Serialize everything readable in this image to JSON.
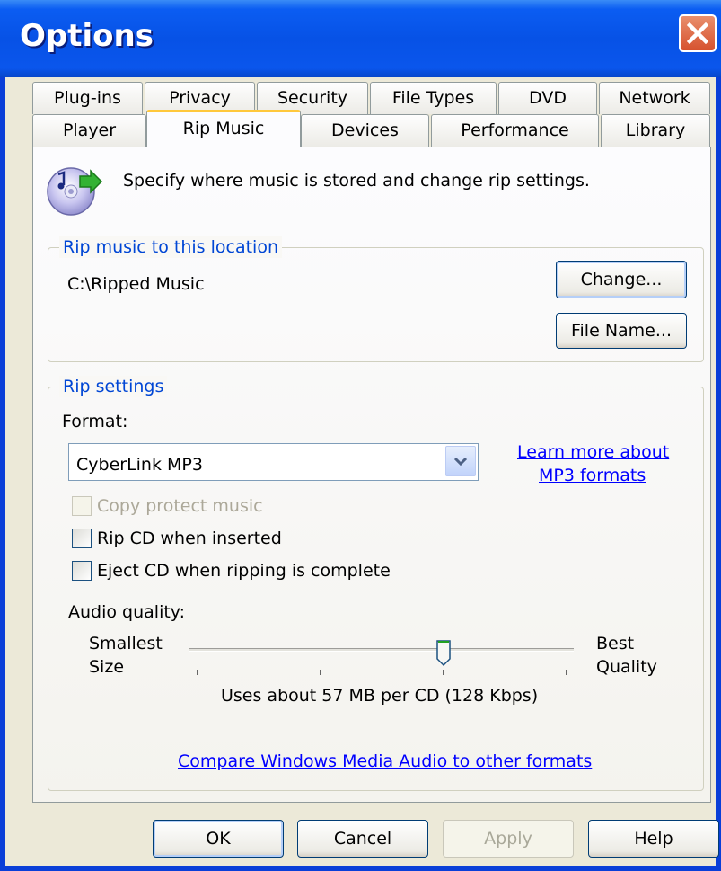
{
  "window": {
    "title": "Options"
  },
  "tabs": {
    "row1": [
      "Plug-ins",
      "Privacy",
      "Security",
      "File Types",
      "DVD",
      "Network"
    ],
    "row2": [
      "Player",
      "Rip Music",
      "Devices",
      "Performance",
      "Library"
    ],
    "active": "Rip Music"
  },
  "header": {
    "icon": "music-cd-rip-icon",
    "description": "Specify where music is stored and change rip settings."
  },
  "location_group": {
    "legend": "Rip music to this location",
    "path": "C:\\Ripped Music",
    "change_button": "Change...",
    "filename_button": "File Name..."
  },
  "settings_group": {
    "legend": "Rip settings",
    "format_label": "Format:",
    "format_value": "CyberLink MP3",
    "learn_more_line1": "Learn more about",
    "learn_more_line2": "MP3 formats",
    "copy_protect": {
      "label": "Copy protect music",
      "checked": false,
      "enabled": false
    },
    "rip_when_inserted": {
      "label": "Rip CD when inserted",
      "checked": false
    },
    "eject_when_complete": {
      "label": "Eject CD when ripping is complete",
      "checked": false
    },
    "audio_quality_label": "Audio quality:",
    "slider_left_line1": "Smallest",
    "slider_left_line2": "Size",
    "slider_right_line1": "Best",
    "slider_right_line2": "Quality",
    "slider_level": 0.65,
    "usage_text": "Uses about 57 MB per CD (128 Kbps)",
    "compare_link": "Compare Windows Media Audio to other formats"
  },
  "footer": {
    "ok": "OK",
    "cancel": "Cancel",
    "apply": "Apply",
    "help": "Help"
  },
  "colors": {
    "titlebar": "#0752e6",
    "dialog_bg": "#ece9d8",
    "legend_text": "#0046d5",
    "link": "#0000ff",
    "active_tab_accent": "#ffc83c",
    "close_button": "#d6522f"
  }
}
